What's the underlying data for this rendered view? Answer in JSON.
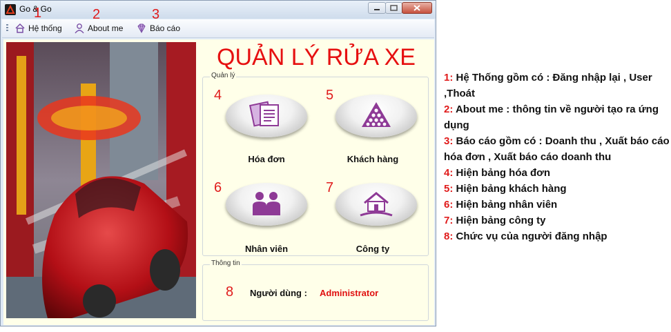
{
  "window": {
    "title": "Go & Go",
    "controls": {
      "minimize": "minimize-icon",
      "maximize": "maximize-icon",
      "close": "close-icon"
    }
  },
  "toolbar": {
    "items": [
      {
        "label": "Hệ thống",
        "icon": "home-icon",
        "number": "1"
      },
      {
        "label": "About me",
        "icon": "user-icon",
        "number": "2"
      },
      {
        "label": "Báo cáo",
        "icon": "diamond-icon",
        "number": "3"
      }
    ]
  },
  "main": {
    "heading": "QUẢN LÝ RỬA XE",
    "manage_group": {
      "title": "Quản lý",
      "tiles": [
        {
          "number": "4",
          "label": "Hóa đơn",
          "icon": "invoice-documents-icon"
        },
        {
          "number": "5",
          "label": "Khách hàng",
          "icon": "billiard-balls-icon"
        },
        {
          "number": "6",
          "label": "Nhân viên",
          "icon": "employees-icon"
        },
        {
          "number": "7",
          "label": "Công ty",
          "icon": "company-house-icon"
        }
      ]
    },
    "info_group": {
      "title": "Thông tin",
      "number": "8",
      "user_label": "Người dùng :",
      "user_value": "Administrator"
    },
    "image": "car-wash-image"
  },
  "notes": [
    {
      "n": "1:",
      "text": " Hệ Thống gồm có : Đăng nhập lại , User ,Thoát"
    },
    {
      "n": "2:",
      "text": " About me : thông tin về người tạo ra ứng dụng"
    },
    {
      "n": "3:",
      "text": " Báo cáo gồm có : Doanh thu , Xuất báo cáo hóa đơn , Xuất báo cáo doanh thu"
    },
    {
      "n": "4:",
      "text": " Hiện bảng hóa đơn"
    },
    {
      "n": "5:",
      "text": " Hiện bảng khách hàng"
    },
    {
      "n": "6:",
      "text": " Hiện bảng nhân viên"
    },
    {
      "n": "7:",
      "text": " Hiện bảng công ty"
    },
    {
      "n": "8:",
      "text": " Chức vụ của người đăng nhập"
    }
  ],
  "colors": {
    "accent_red": "#e01b1b",
    "tile_icon": "#8e3a96",
    "panel_bg": "#ffffe9"
  }
}
